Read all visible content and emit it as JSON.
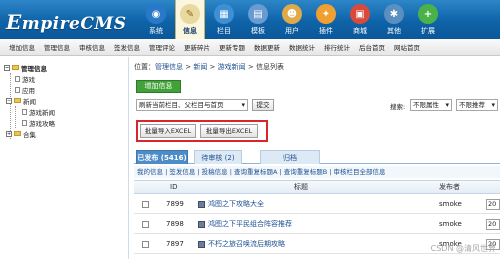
{
  "header": {
    "logo": "EmpireCMS",
    "nav": [
      {
        "label": "系统",
        "icon": "globe-icon",
        "color": "#2a78c9",
        "glyph": "◉",
        "active": false
      },
      {
        "label": "信息",
        "icon": "document-icon",
        "color": "#e8d9a0",
        "glyph": "✎",
        "active": true
      },
      {
        "label": "栏目",
        "icon": "columns-icon",
        "color": "#3f8fd6",
        "glyph": "▦",
        "active": false
      },
      {
        "label": "模板",
        "icon": "template-icon",
        "color": "#6a9bd0",
        "glyph": "▤",
        "active": false
      },
      {
        "label": "用户",
        "icon": "user-icon",
        "color": "#e0a94a",
        "glyph": "☻",
        "active": false
      },
      {
        "label": "插件",
        "icon": "plugin-icon",
        "color": "#f0a030",
        "glyph": "✦",
        "active": false
      },
      {
        "label": "商城",
        "icon": "shop-icon",
        "color": "#d94a3a",
        "glyph": "▣",
        "active": false
      },
      {
        "label": "其他",
        "icon": "gear-icon",
        "color": "#5a8fc0",
        "glyph": "✱",
        "active": false
      },
      {
        "label": "扩展",
        "icon": "plus-icon",
        "color": "#4bb24a",
        "glyph": "+",
        "active": false
      }
    ]
  },
  "subnav": [
    "增加信息",
    "管理信息",
    "审核信息",
    "签发信息",
    "管理评论",
    "更新碎片",
    "更新专题",
    "数据更新",
    "数据统计",
    "排行统计",
    "后台首页",
    "网站首页"
  ],
  "tree": {
    "root": "管理信息",
    "items": [
      "游戏",
      "应用",
      "新闻",
      "游戏新闻",
      "游戏攻略",
      "合集"
    ]
  },
  "breadcrumb": {
    "prefix": "位置：",
    "parts": [
      "管理信息",
      "新闻",
      "游戏新闻",
      "信息列表"
    ],
    "sep": " > "
  },
  "toolbar": {
    "add": "增加信息",
    "refresh_select": "刷新当前栏目、父栏目与首页",
    "submit": "提交",
    "search_label": "搜索:",
    "attr_select": "不限属性",
    "rec_select": "不限推荐",
    "import_excel": "批量导入EXCEL",
    "export_excel": "批量导出EXCEL"
  },
  "tabs": [
    "已发布 (5416)",
    "待审核 (2)",
    "归档"
  ],
  "filter_links": "我的信息 | 签发信息 | 投稿信息 | 查询重复标题A | 查询重复标题B | 审核栏目全部信息",
  "table": {
    "columns": [
      "ID",
      "标题",
      "发布者"
    ],
    "rows": [
      {
        "id": "7899",
        "title": "鸿图之下攻略大全",
        "author": "smoke",
        "date": "20"
      },
      {
        "id": "7898",
        "title": "鸿图之下平民组合阵容推荐",
        "author": "smoke",
        "date": "20"
      },
      {
        "id": "7897",
        "title": "不朽之旅召唤流后期攻略",
        "author": "smoke",
        "date": "20"
      }
    ]
  },
  "watermark": "CSDN @清风世界"
}
